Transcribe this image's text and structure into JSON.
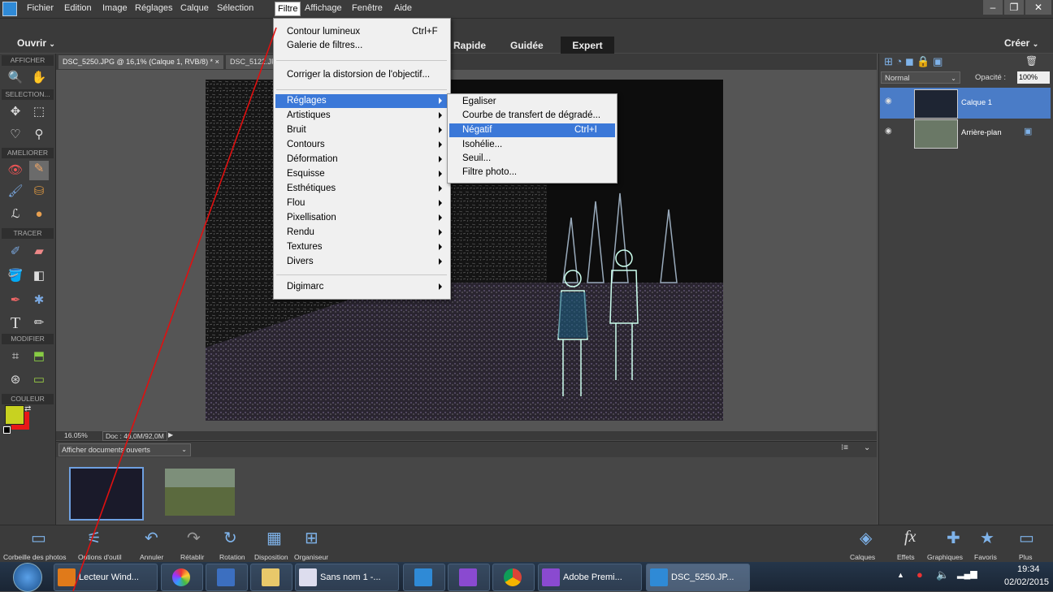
{
  "menubar": {
    "items": [
      "Fichier",
      "Edition",
      "Image",
      "Réglages",
      "Calque",
      "Sélection",
      "Filtre",
      "Affichage",
      "Fenêtre",
      "Aide"
    ]
  },
  "modebar": {
    "open_label": "Ouvrir",
    "rapide": "Rapide",
    "guidee": "Guidée",
    "expert": "Expert",
    "creer": "Créer"
  },
  "toolbar": {
    "sections": [
      "AFFICHER",
      "SELECTION...",
      "AMELIORER",
      "TRACER",
      "MODIFIER",
      "COULEUR"
    ]
  },
  "tabs": [
    {
      "label": "DSC_5250.JPG @ 16,1% (Calque 1, RVB/8) *  ×"
    },
    {
      "label": "DSC_5122.JP"
    }
  ],
  "status": {
    "zoom": "16.05%",
    "doc": "Doc : 46,0M/92,0M"
  },
  "bin": {
    "dropdown": "Afficher documents ouverts"
  },
  "layers_panel": {
    "blend_mode": "Normal",
    "opacity_label": "Opacité :",
    "opacity_value": "100%",
    "layers": [
      {
        "name": "Calque 1",
        "selected": true
      },
      {
        "name": "Arrière-plan",
        "selected": false
      }
    ]
  },
  "filter_menu": {
    "top": [
      {
        "label": "Contour lumineux",
        "shortcut": "Ctrl+F"
      },
      {
        "label": "Galerie de filtres..."
      }
    ],
    "middle": [
      {
        "label": "Corriger la distorsion de l'objectif..."
      }
    ],
    "items": [
      "Réglages",
      "Artistiques",
      "Bruit",
      "Contours",
      "Déformation",
      "Esquisse",
      "Esthétiques",
      "Flou",
      "Pixellisation",
      "Rendu",
      "Textures",
      "Divers"
    ],
    "last": "Digimarc",
    "highlighted": "Réglages"
  },
  "submenu": {
    "items": [
      {
        "label": "Egaliser"
      },
      {
        "label": "Courbe de transfert de dégradé..."
      },
      {
        "label": "Négatif",
        "shortcut": "Ctrl+I"
      },
      {
        "label": "Isohélie..."
      },
      {
        "label": "Seuil..."
      },
      {
        "label": "Filtre photo..."
      }
    ],
    "highlighted": "Négatif"
  },
  "bottombar": {
    "left": [
      "Corbeille des photos",
      "Options d'outil",
      "Annuler",
      "Rétablir",
      "Rotation",
      "Disposition",
      "Organiseur"
    ],
    "right": [
      "Calques",
      "Effets",
      "Graphiques",
      "Favoris",
      "Plus"
    ]
  },
  "taskbar": {
    "items": [
      {
        "label": "Lecteur Wind...",
        "icon": "media-player-icon"
      },
      {
        "label": "",
        "icon": "picasa-icon"
      },
      {
        "label": "",
        "icon": "book-icon"
      },
      {
        "label": "",
        "icon": "folder-icon"
      },
      {
        "label": "Sans nom 1 -...",
        "icon": "document-icon"
      },
      {
        "label": "",
        "icon": "photoshop-elements-icon"
      },
      {
        "label": "",
        "icon": "premiere-elements-icon"
      },
      {
        "label": "",
        "icon": "chrome-icon"
      },
      {
        "label": "Adobe Premi...",
        "icon": "premiere-icon"
      },
      {
        "label": "DSC_5250.JP...",
        "icon": "photoshop-elements-icon"
      }
    ],
    "time": "19:34",
    "date": "02/02/2015"
  },
  "colors": {
    "accent_blue": "#4a7cc7",
    "menu_highlight": "#3b78d8",
    "fg_color": "#c8d220",
    "bg_color": "#e81818"
  }
}
